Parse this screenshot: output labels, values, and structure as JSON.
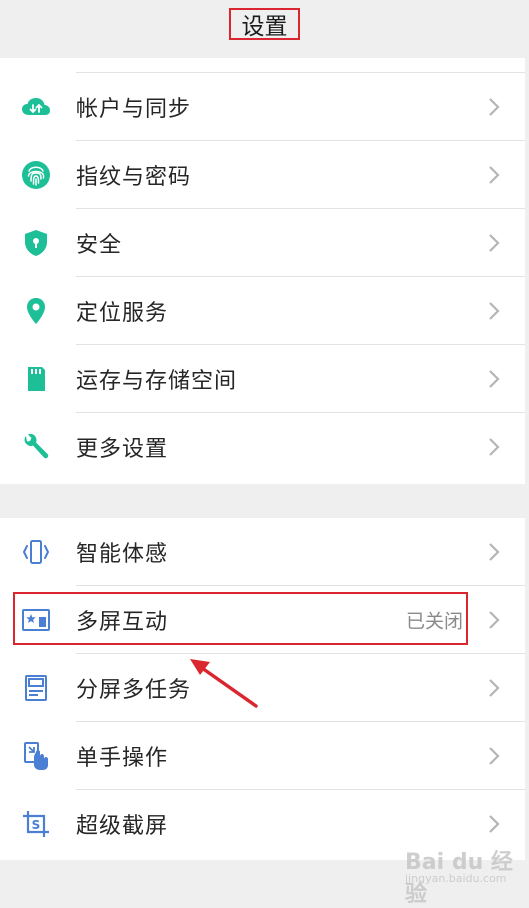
{
  "header": {
    "title": "设置"
  },
  "group1": {
    "items": [
      {
        "label": "帐户与同步",
        "icon": "cloud-sync-icon"
      },
      {
        "label": "指纹与密码",
        "icon": "fingerprint-icon"
      },
      {
        "label": "安全",
        "icon": "shield-icon"
      },
      {
        "label": "定位服务",
        "icon": "location-pin-icon"
      },
      {
        "label": "运存与存储空间",
        "icon": "sd-card-icon"
      },
      {
        "label": "更多设置",
        "icon": "wrench-icon"
      }
    ]
  },
  "group2": {
    "items": [
      {
        "label": "智能体感",
        "icon": "motion-sense-icon"
      },
      {
        "label": "多屏互动",
        "icon": "multi-screen-icon",
        "status": "已关闭"
      },
      {
        "label": "分屏多任务",
        "icon": "split-screen-icon"
      },
      {
        "label": "单手操作",
        "icon": "one-hand-icon"
      },
      {
        "label": "超级截屏",
        "icon": "screenshot-icon"
      }
    ]
  },
  "watermark": {
    "main": "Bai du 经验",
    "sub": "jingyan.baidu.com"
  },
  "colors": {
    "green_icon": "#1dbf96",
    "blue_icon": "#4a7fd4",
    "annotation_red": "#d9262f",
    "background": "#efefef"
  }
}
